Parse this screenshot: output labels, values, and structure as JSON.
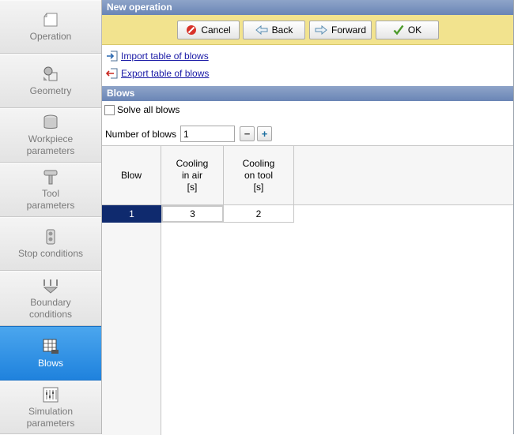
{
  "sidebar": {
    "items": [
      {
        "label": "Operation",
        "icon": "operation-icon",
        "active": false
      },
      {
        "label": "Geometry",
        "icon": "geometry-icon",
        "active": false
      },
      {
        "label": "Workpiece\nparameters",
        "icon": "workpiece-icon",
        "active": false
      },
      {
        "label": "Tool\nparameters",
        "icon": "tool-icon",
        "active": false
      },
      {
        "label": "Stop conditions",
        "icon": "stop-conditions-icon",
        "active": false
      },
      {
        "label": "Boundary\nconditions",
        "icon": "boundary-conditions-icon",
        "active": false
      },
      {
        "label": "Blows",
        "icon": "blows-icon",
        "active": true
      },
      {
        "label": "Simulation\nparameters",
        "icon": "simulation-parameters-icon",
        "active": false
      }
    ]
  },
  "header": {
    "title": "New operation"
  },
  "toolbar": {
    "cancel_label": "Cancel",
    "back_label": "Back",
    "forward_label": "Forward",
    "ok_label": "OK"
  },
  "links": {
    "import_label": "Import table of blows",
    "export_label": "Export table of blows"
  },
  "blows_section": {
    "title": "Blows",
    "solve_all_label": "Solve all blows",
    "solve_all_checked": false,
    "number_label": "Number of blows",
    "number_value": "1",
    "minus": "−",
    "plus": "+"
  },
  "table": {
    "columns": [
      "Blow",
      "Cooling\nin air\n[s]",
      "Cooling\non tool\n[s]"
    ],
    "rows": [
      {
        "blow": "1",
        "cooling_in_air": "3",
        "cooling_on_tool": "2"
      }
    ]
  },
  "colors": {
    "active_sidebar": "#2a8be3",
    "toolbar_bg": "#f2e38e",
    "header_bg": "#6f89b9",
    "selected_row": "#0f2a6e"
  }
}
